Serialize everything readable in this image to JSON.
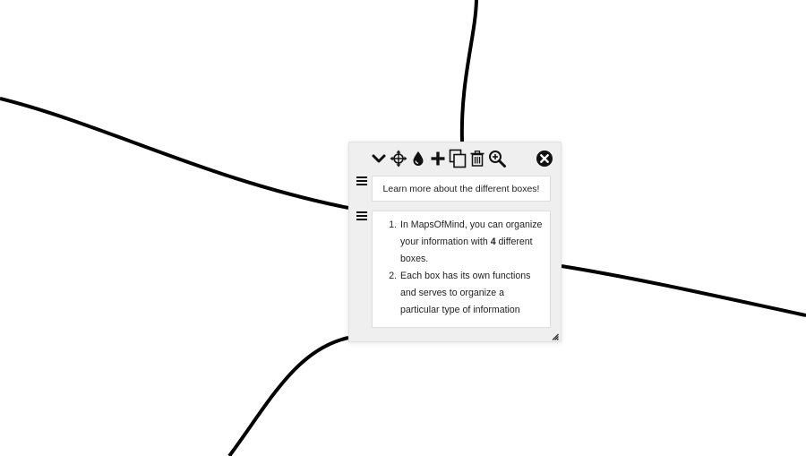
{
  "toolbar": {
    "tools": [
      {
        "id": "collapse",
        "icon": "chevron-down-icon"
      },
      {
        "id": "move",
        "icon": "move-arrows-icon"
      },
      {
        "id": "color",
        "icon": "droplet-icon"
      },
      {
        "id": "add",
        "icon": "plus-icon"
      },
      {
        "id": "copy",
        "icon": "copy-icon"
      },
      {
        "id": "delete",
        "icon": "trash-icon"
      },
      {
        "id": "zoom",
        "icon": "zoom-in-icon"
      }
    ],
    "close": {
      "icon": "close-circle-icon"
    }
  },
  "box": {
    "title": "Learn more about the different boxes!",
    "list": [
      {
        "before": "In MapsOfMind, you can organize your information with ",
        "bold": "4",
        "after": " different boxes."
      },
      {
        "before": "Each box has its own functions and serves to organize a particular type of information",
        "bold": "",
        "after": ""
      }
    ]
  },
  "colors": {
    "box_background": "#efefef",
    "connector": "#000000",
    "icon": "#111111"
  }
}
